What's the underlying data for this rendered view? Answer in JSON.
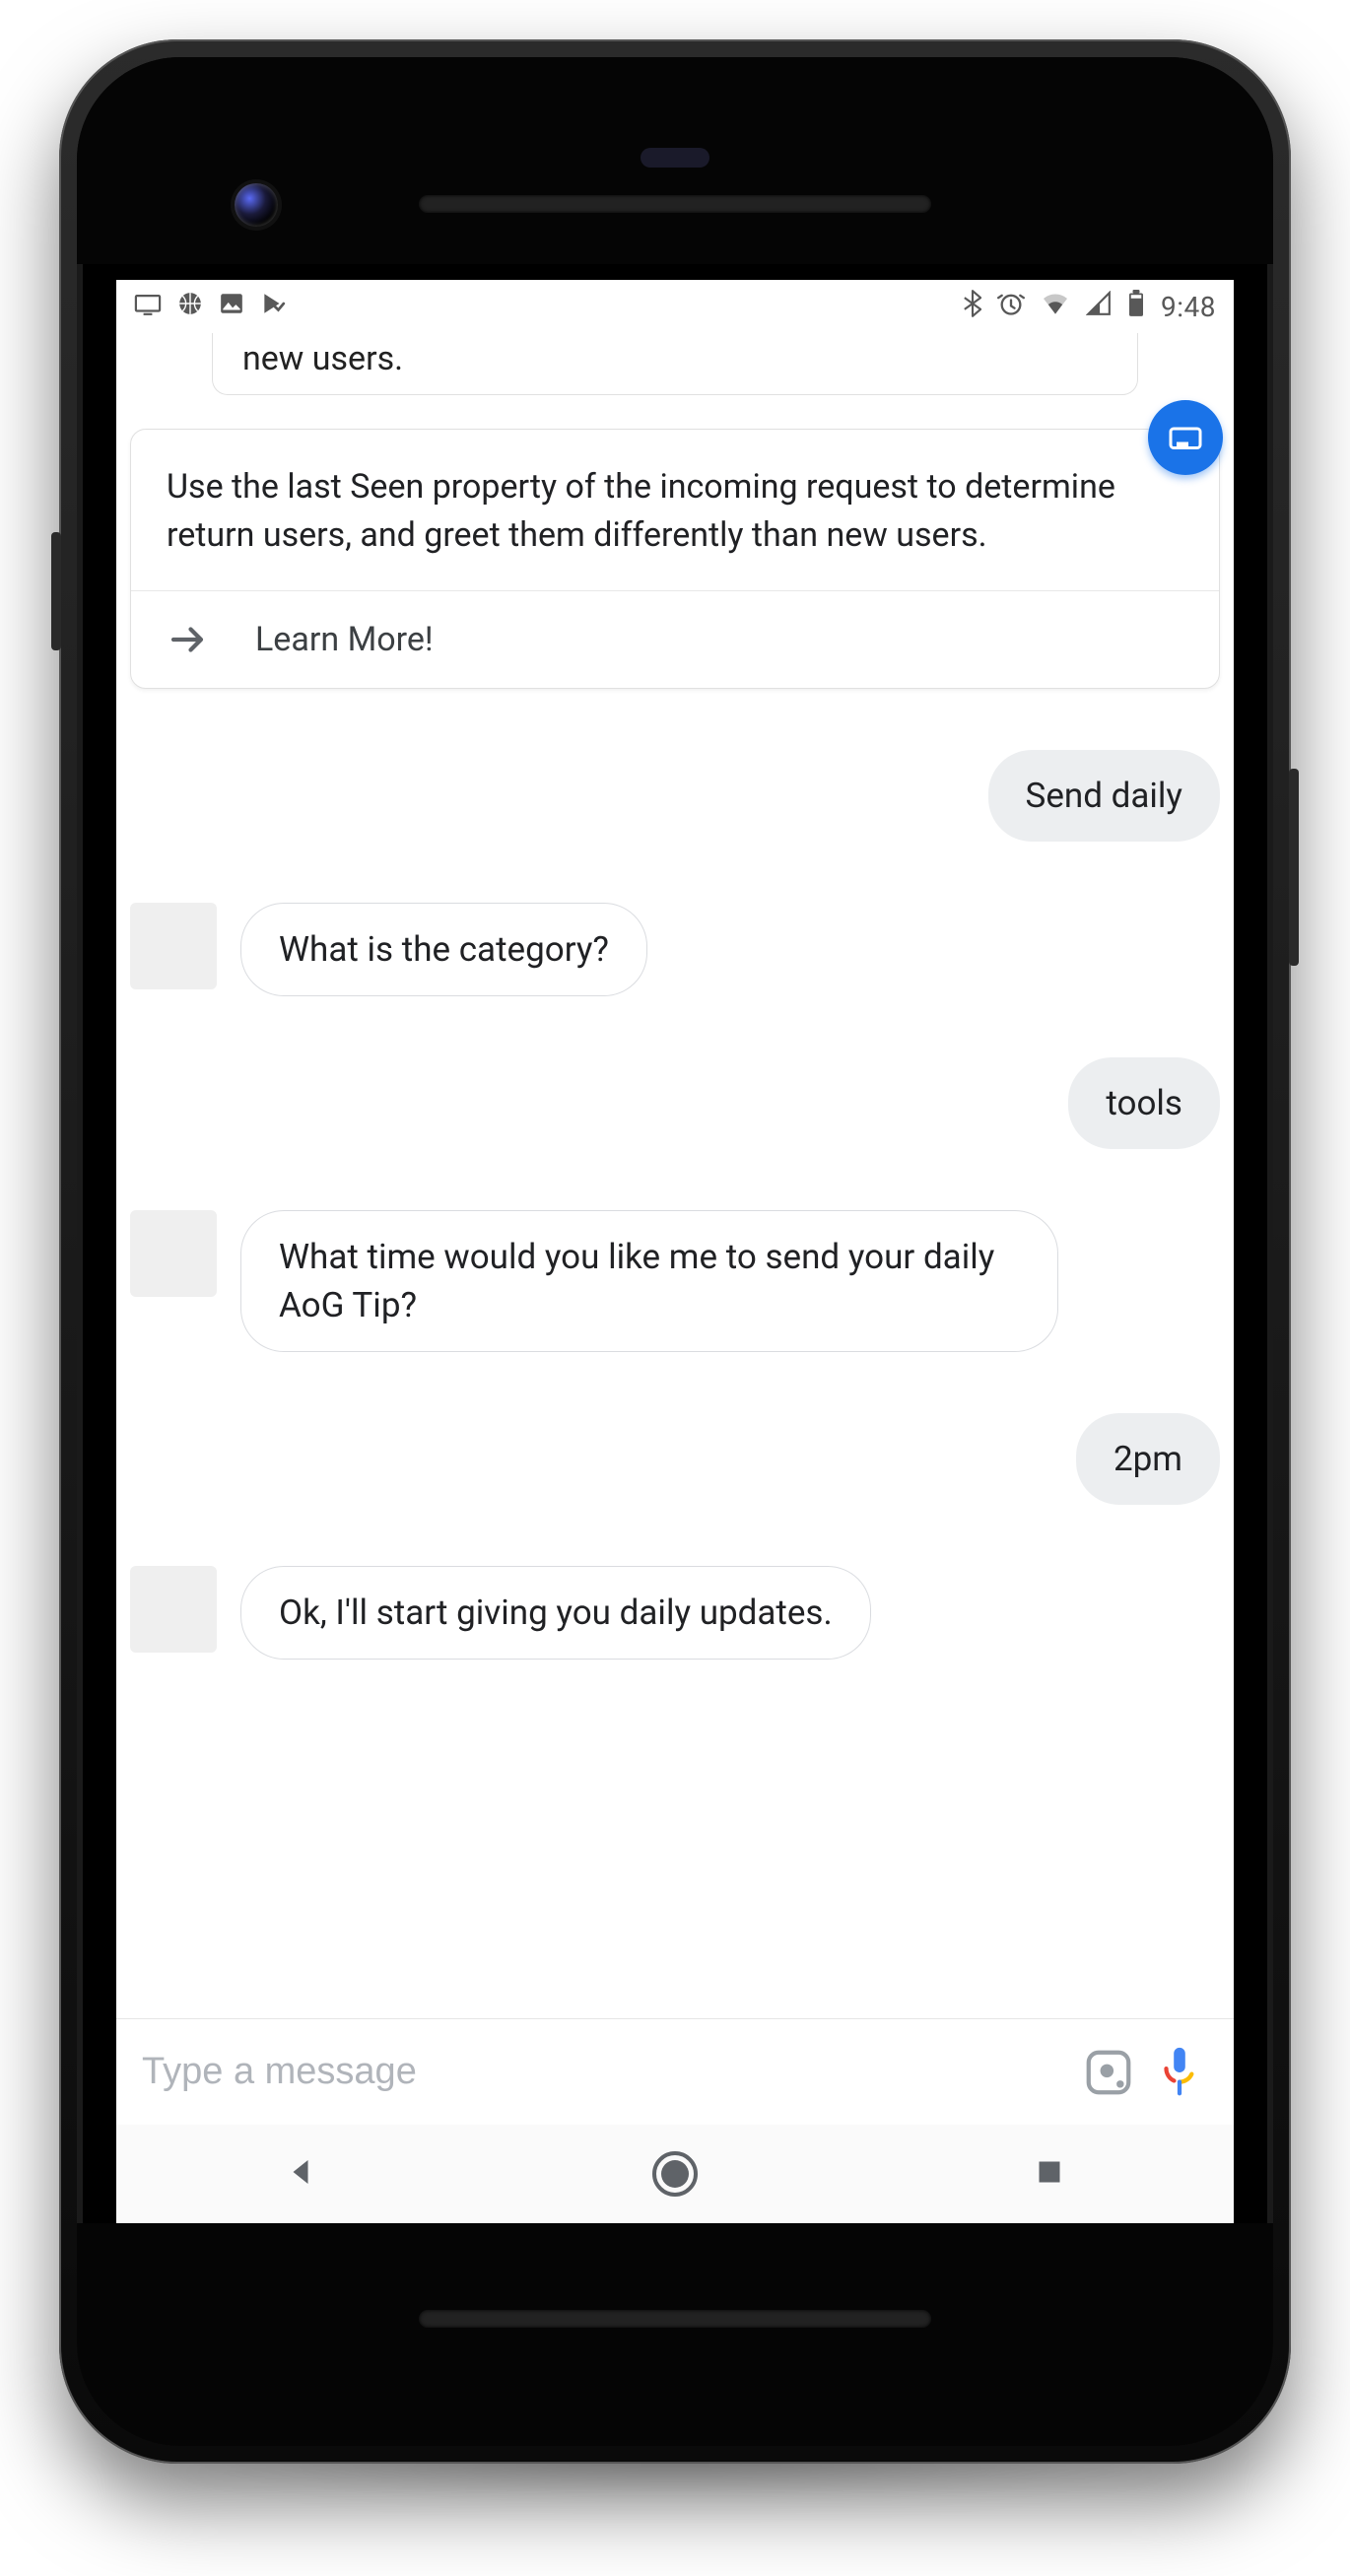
{
  "status": {
    "time": "9:48",
    "icons_left": [
      "display-icon",
      "basketball-icon",
      "image-icon",
      "play-checked-icon"
    ],
    "icons_right": [
      "bluetooth-icon",
      "alarm-icon",
      "wifi-icon",
      "cell-signal-icon",
      "battery-icon"
    ]
  },
  "peek_card_text": "new users.",
  "tip_card": {
    "body": "Use the last Seen property of the incoming request to determine return users, and greet them differently than new users.",
    "action_label": "Learn More!"
  },
  "conversation": [
    {
      "role": "user",
      "text": "Send daily"
    },
    {
      "role": "assistant",
      "text": "What is the category?"
    },
    {
      "role": "user",
      "text": "tools"
    },
    {
      "role": "assistant",
      "text": "What time would you like me to send your daily AoG Tip?"
    },
    {
      "role": "user",
      "text": "2pm"
    },
    {
      "role": "assistant",
      "text": "Ok, I'll start giving you daily updates."
    }
  ],
  "compose": {
    "placeholder": "Type a message"
  },
  "colors": {
    "accent": "#1a73e8",
    "bubble_user_bg": "#eceef0",
    "border": "#dadce0"
  }
}
